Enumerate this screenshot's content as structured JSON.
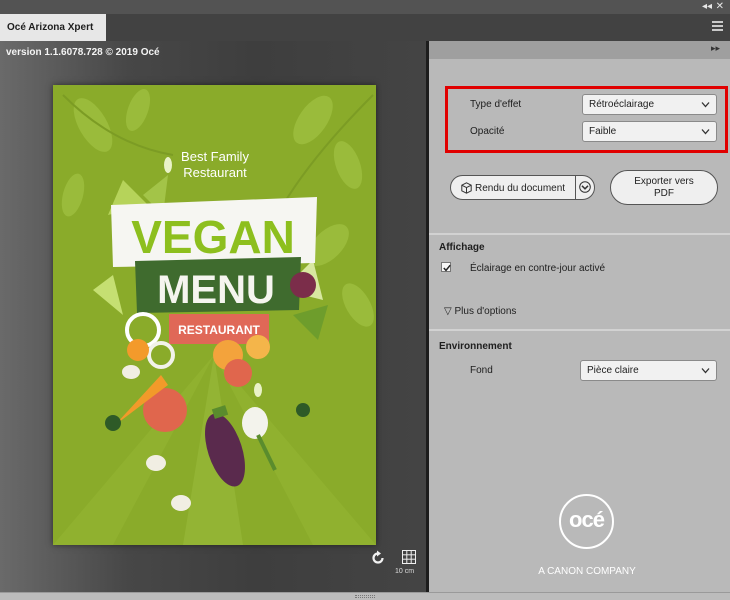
{
  "window": {
    "collapse_glyph": "◂◂",
    "close_glyph": "✕"
  },
  "tabs": [
    {
      "label": "Océ Arizona Xpert",
      "active": true
    }
  ],
  "preview": {
    "version_text": "version 1.1.6078.728 © 2019 Océ",
    "poster": {
      "line1": "Best Family",
      "line2": "Restaurant",
      "headline1": "VEGAN",
      "headline2": "MENU",
      "tag": "RESTAURANT",
      "colors": {
        "background": "#8aab2a",
        "headline1": "#8dbf1e",
        "menu_bg": "#3f6b2e",
        "tag_bg": "#e06857"
      }
    },
    "scale_label": "10 cm"
  },
  "panel": {
    "expand_glyph": "▸▸",
    "effect": {
      "type_label": "Type d'effet",
      "type_value": "Rétroéclairage",
      "opacity_label": "Opacité",
      "opacity_value": "Faible"
    },
    "render_button": "Rendu du document",
    "export_button_line1": "Exporter vers",
    "export_button_line2": "PDF",
    "affichage": {
      "title": "Affichage",
      "backlight_checkbox_label": "Éclairage en contre-jour activé",
      "backlight_checked": true,
      "more_options": "Plus d'options"
    },
    "environnement": {
      "title": "Environnement",
      "background_label": "Fond",
      "background_value": "Pièce claire"
    },
    "brand": {
      "logo_text": "océ",
      "tagline": "A CANON COMPANY"
    }
  },
  "icons": [
    "collapse-icon",
    "close-icon",
    "panel-menu-icon",
    "expand-panel-icon",
    "refresh-icon",
    "grid-icon",
    "cube-icon",
    "dropdown-chevron-icon",
    "checkmark-icon",
    "triangle-down-icon"
  ],
  "colors": {
    "highlight": "#e10000",
    "accent_dark": "#424242"
  }
}
